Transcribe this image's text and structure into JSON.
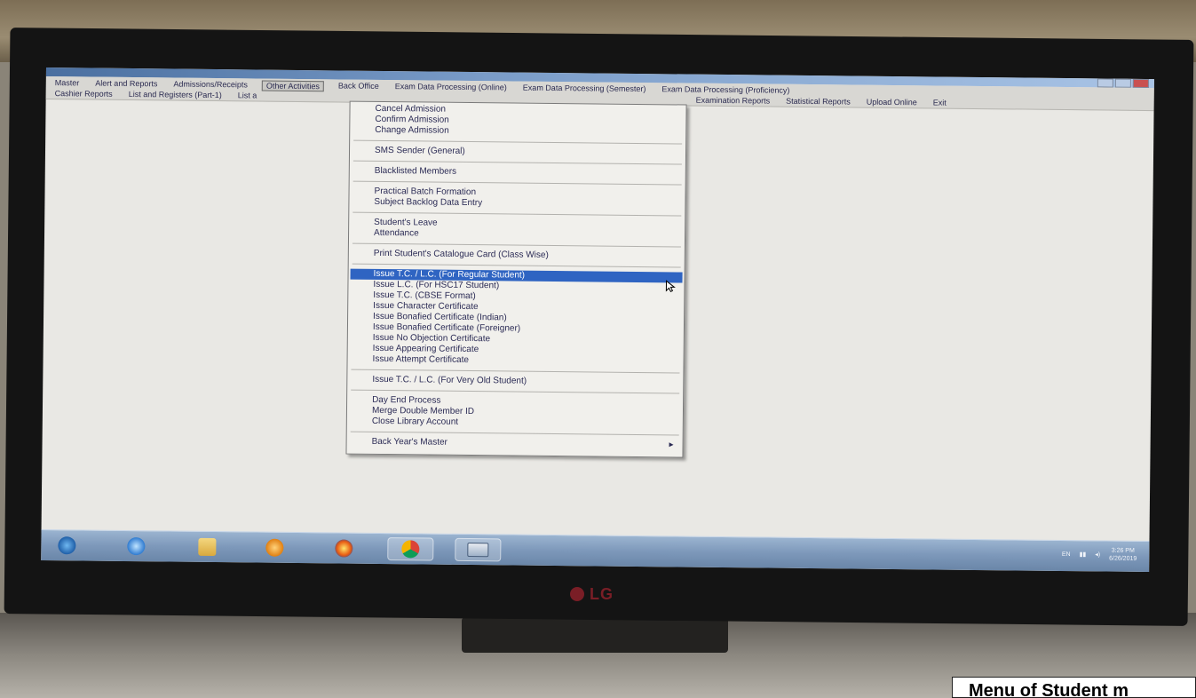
{
  "window": {
    "title": ""
  },
  "menubar": {
    "row1": [
      "Master",
      "Alert and Reports",
      "Admissions/Receipts",
      "Other Activities",
      "Back Office",
      "Exam Data Processing (Online)",
      "Exam Data Processing (Semester)",
      "Exam Data Processing (Proficiency)"
    ],
    "row2_left": [
      "Cashier Reports",
      "List and Registers (Part-1)",
      "List a"
    ],
    "row2_right": [
      "Examination Reports",
      "Statistical Reports",
      "Upload Online",
      "Exit"
    ],
    "active": "Other Activities"
  },
  "dropdown": {
    "groups": [
      [
        "Cancel Admission",
        "Confirm Admission",
        "Change Admission"
      ],
      [
        "SMS Sender (General)"
      ],
      [
        "Blacklisted Members"
      ],
      [
        "Practical Batch Formation",
        "Subject Backlog Data Entry"
      ],
      [
        "Student's Leave",
        "Attendance"
      ],
      [
        "Print Student's Catalogue Card (Class Wise)"
      ],
      [
        "Issue T.C. / L.C. (For Regular Student)",
        "Issue L.C. (For HSC17 Student)",
        "Issue T.C. (CBSE Format)",
        "Issue Character Certificate",
        "Issue Bonafied Certificate (Indian)",
        "Issue Bonafied Certificate (Foreigner)",
        "Issue No Objection Certificate",
        "Issue Appearing Certificate",
        "Issue Attempt Certificate"
      ],
      [
        "Issue T.C. / L.C. (For Very Old Student)"
      ],
      [
        "Day End Process",
        "Merge Double Member ID",
        "Close Library Account"
      ],
      [
        "Back Year's Master"
      ]
    ],
    "selected": "Issue T.C. / L.C. (For Regular Student)",
    "submenu_item": "Back Year's Master"
  },
  "taskbar": {
    "icons": [
      "start-orb-icon",
      "internet-explorer-icon",
      "folder-icon",
      "media-player-icon",
      "firefox-icon",
      "chrome-icon",
      "app-window-icon"
    ],
    "tray_language": "EN",
    "time": "3:26 PM",
    "date": "6/26/2019"
  },
  "brand": "LG",
  "caption": "Menu of Student m",
  "colors": {
    "selection": "#2f64c2",
    "menu_text": "#2b2b55",
    "taskbar": "#7d98ba",
    "brand": "#7a1e26"
  }
}
